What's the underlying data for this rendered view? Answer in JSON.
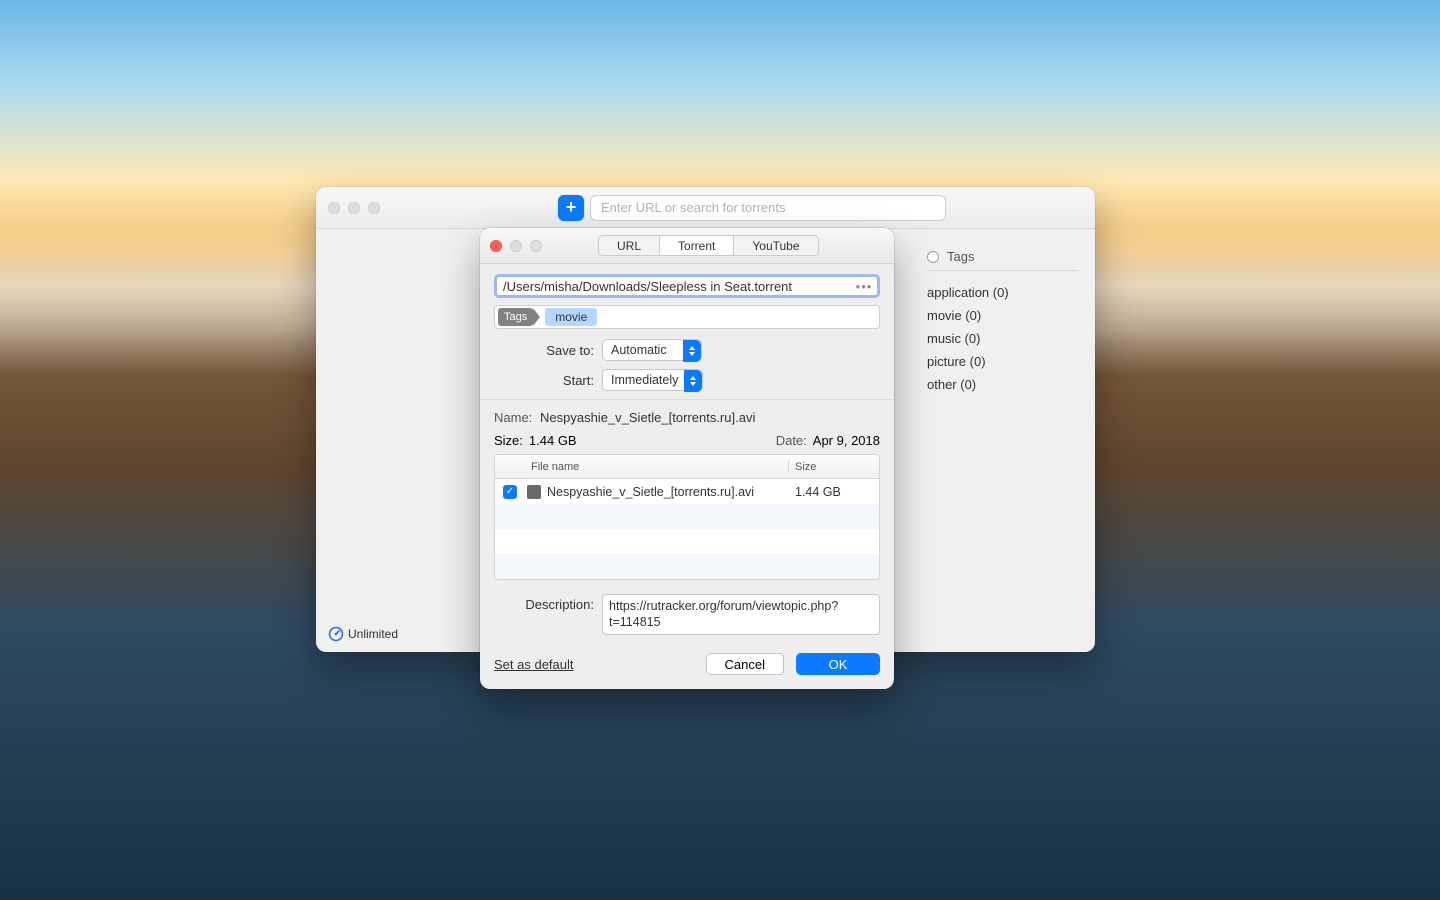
{
  "main": {
    "search_placeholder": "Enter URL or search for torrents",
    "status": "Unlimited",
    "sidebar": {
      "title": "Tags",
      "items": [
        {
          "label": "application (0)"
        },
        {
          "label": "movie (0)"
        },
        {
          "label": "music (0)"
        },
        {
          "label": "picture (0)"
        },
        {
          "label": "other (0)"
        }
      ]
    }
  },
  "modal": {
    "tabs": {
      "url": "URL",
      "torrent": "Torrent",
      "youtube": "YouTube"
    },
    "file_path": "/Users/misha/Downloads/Sleepless in Seat.torrent",
    "tags_label": "Tags",
    "tag_chip": "movie",
    "save_to_label": "Save to:",
    "save_to_value": "Automatic",
    "start_label": "Start:",
    "start_value": "Immediately",
    "name_label": "Name:",
    "name_value": "Nespyashie_v_Sietle_[torrents.ru].avi",
    "size_label": "Size:",
    "size_value": "1.44 GB",
    "date_label": "Date:",
    "date_value": "Apr 9, 2018",
    "table": {
      "col_name": "File name",
      "col_size": "Size",
      "rows": [
        {
          "name": "Nespyashie_v_Sietle_[torrents.ru].avi",
          "size": "1.44 GB"
        }
      ]
    },
    "description_label": "Description:",
    "description_value": "https://rutracker.org/forum/viewtopic.php?t=114815",
    "set_default": "Set as default",
    "cancel": "Cancel",
    "ok": "OK"
  }
}
